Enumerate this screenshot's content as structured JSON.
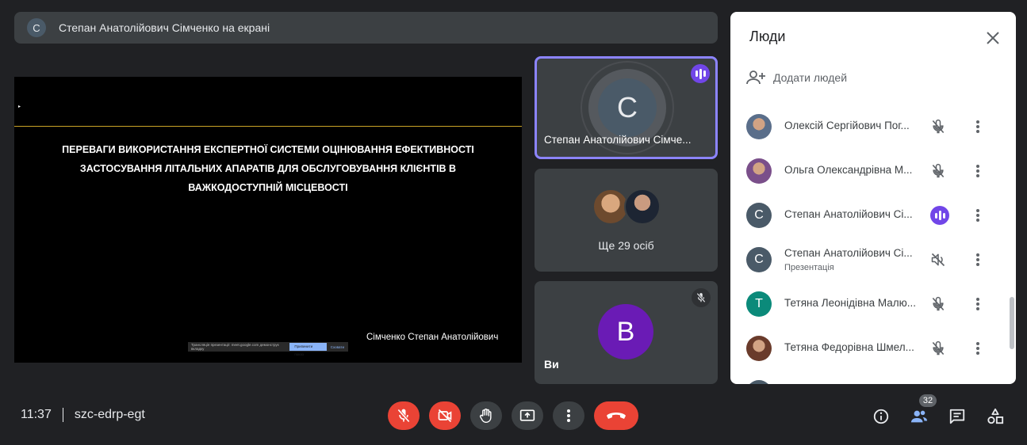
{
  "banner": {
    "avatar_letter": "С",
    "text": "Степан Анатолійович Сімченко на екрані"
  },
  "presentation": {
    "title": "ПЕРЕВАГИ ВИКОРИСТАННЯ ЕКСПЕРТНОЇ СИСТЕМИ ОЦІНЮВАННЯ ЕФЕКТИВНОСТІ ЗАСТОСУВАННЯ ЛІТАЛЬНИХ АПАРАТІВ ДЛЯ ОБСЛУГОВУВАННЯ КЛІЄНТІВ В ВАЖКОДОСТУПНІЙ МІСЦЕВОСТІ",
    "author": "Сімченко Степан Анатолійович",
    "share_bar_text": "Трансляція презентації: meet.google.com демонструє вкладку",
    "share_bar_stop": "Припинити показ",
    "share_bar_hide": "Сховати"
  },
  "tiles": {
    "main": {
      "avatar_letter": "С",
      "name": "Степан Анатолійович Сімче..."
    },
    "others": {
      "more_label": "Ще 29 осіб"
    },
    "self": {
      "avatar_letter": "B",
      "name": "Ви"
    }
  },
  "people_panel": {
    "title": "Люди",
    "add_label": "Додати людей",
    "participants": [
      {
        "name": "Олексій Сергійович Пог...",
        "avatar_type": "photo",
        "photo_color": "#5a6e8a",
        "mic": "muted"
      },
      {
        "name": "Ольга Олександрівна М...",
        "avatar_type": "photo",
        "photo_color": "#7a4f8a",
        "mic": "muted"
      },
      {
        "name": "Степан Анатолійович Сі...",
        "avatar_type": "letter",
        "letter": "С",
        "color": "#4a5a68",
        "mic": "speaking"
      },
      {
        "name": "Степан Анатолійович Сі...",
        "subtitle": "Презентація",
        "avatar_type": "letter",
        "letter": "С",
        "color": "#4a5a68",
        "mic": "audio-off"
      },
      {
        "name": "Тетяна Леонідівна Малю...",
        "avatar_type": "letter",
        "letter": "Т",
        "color": "#0b8a7a",
        "mic": "muted"
      },
      {
        "name": "Тетяна Федорівна Шмел...",
        "avatar_type": "photo",
        "photo_color": "#6a3b2b",
        "mic": "muted"
      }
    ]
  },
  "bottom_bar": {
    "time": "11:37",
    "meeting_code": "szc-edrp-egt",
    "participants_count": "32"
  },
  "colors": {
    "accent": "#8c84ff",
    "speaking": "#7146e8",
    "danger": "#ea4335",
    "bg": "#202124"
  }
}
